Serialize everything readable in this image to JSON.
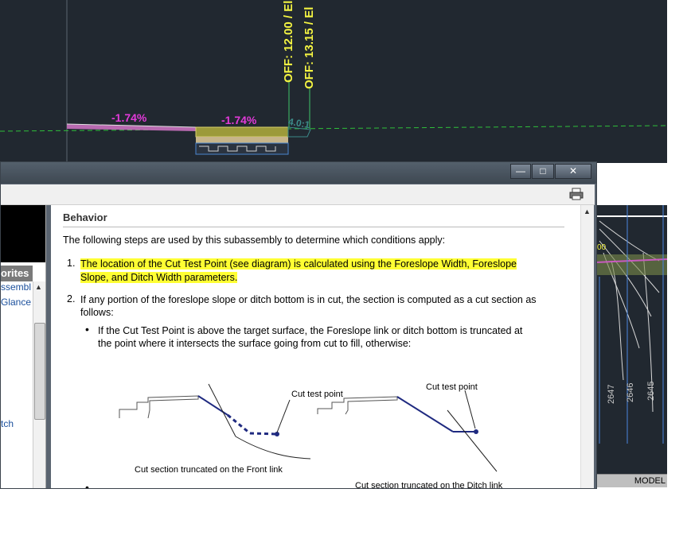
{
  "cad": {
    "label_off_1": "OFF: 12.00 / El",
    "label_off_2": "OFF: 13.15 / El",
    "slope_left": "-1.74%",
    "slope_right": "-1.74%",
    "ratio": "4.0:1",
    "side_label_00": "00",
    "contours": [
      "2647",
      "2646",
      "2645"
    ],
    "model_tab": "MODEL"
  },
  "window": {
    "buttons": {
      "minimize": "—",
      "maximize": "□",
      "close": "✕"
    }
  },
  "nav": {
    "header": "orites",
    "items": [
      "ssembl",
      "Glance",
      "tch"
    ]
  },
  "content": {
    "heading": "Behavior",
    "intro": "The following steps are used by this subassembly to determine which conditions apply:",
    "step1_num": "1.",
    "step1_line1": "The location of the Cut Test Point (see diagram) is calculated using the Foreslope Width, Foreslope",
    "step1_line2": "Slope, and Ditch Width parameters.",
    "step2_num": "2.",
    "step2_line1": "If any portion of the foreslope slope or ditch bottom is in cut, the section is computed as a cut section as",
    "step2_line2": "follows:",
    "bullet1_line1": "If the Cut Test Point is above the target surface, the Foreslope link or ditch bottom is truncated at",
    "bullet1_line2": "the point where it intersects the surface going from cut to fill, otherwise:",
    "diagram": {
      "left_label_top": "Cut test point",
      "left_caption": "Cut section truncated on the Front link",
      "right_label_top": "Cut test point",
      "right_caption": "Cut section truncated on the Ditch link"
    }
  },
  "colors": {
    "cad_bg": "#212830",
    "highlight": "#ffff33",
    "slope_text": "#e23ad9",
    "offset_text": "#f5f542"
  }
}
